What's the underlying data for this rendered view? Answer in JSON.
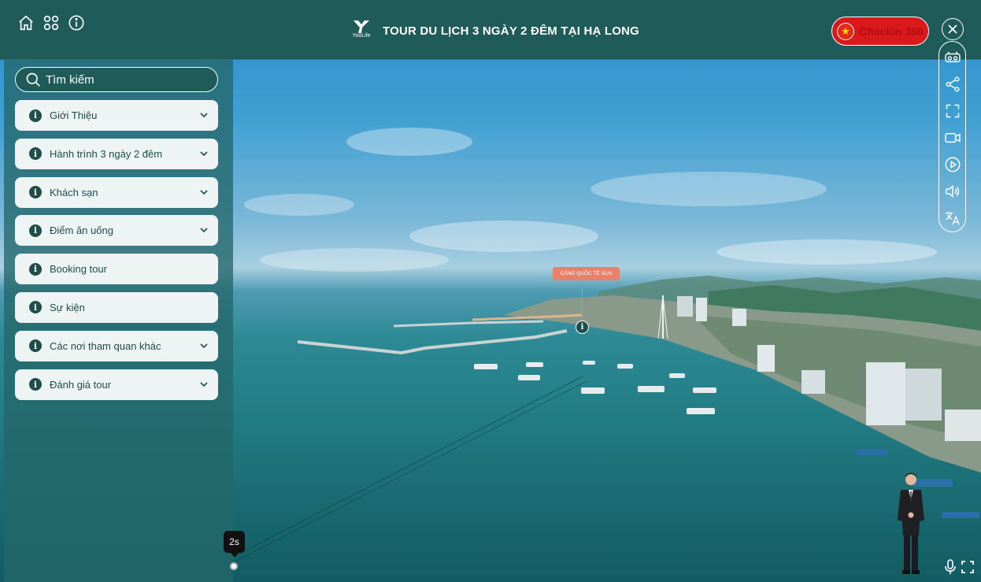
{
  "header": {
    "title": "TOUR DU LỊCH 3 NGÀY 2 ĐÊM TẠI HẠ LONG",
    "logo_text": "YooLife",
    "checkin_label": "Checkin 360"
  },
  "search": {
    "placeholder": "Tìm kiếm"
  },
  "menu": {
    "items": [
      {
        "label": "Giới Thiệu",
        "has_chevron": true
      },
      {
        "label": "Hành trình 3 ngày 2 đêm",
        "has_chevron": true
      },
      {
        "label": "Khách sạn",
        "has_chevron": true
      },
      {
        "label": "Điểm ăn uống",
        "has_chevron": true
      },
      {
        "label": "Booking tour",
        "has_chevron": false
      },
      {
        "label": "Sự kiện",
        "has_chevron": false
      },
      {
        "label": "Các nơi tham quan khác",
        "has_chevron": true
      },
      {
        "label": "Đánh giá tour",
        "has_chevron": true
      }
    ]
  },
  "hotspot": {
    "label": "CẢNG QUỐC TẾ SUN"
  },
  "timer": {
    "label": "2s"
  },
  "colors": {
    "header_bg": "#1f5b58",
    "checkin_bg": "#d9191c",
    "menu_item_bg": "#eef3f4",
    "hotspot": "#e8806a"
  },
  "icons": {
    "top_left": [
      "home-icon",
      "grid-icon",
      "info-icon"
    ],
    "right_bar": [
      "vr-glasses-icon",
      "share-icon",
      "fullscreen-icon",
      "video-icon",
      "play-icon",
      "volume-icon",
      "translate-icon"
    ],
    "bottom_right": [
      "microphone-icon",
      "expand-icon"
    ]
  }
}
